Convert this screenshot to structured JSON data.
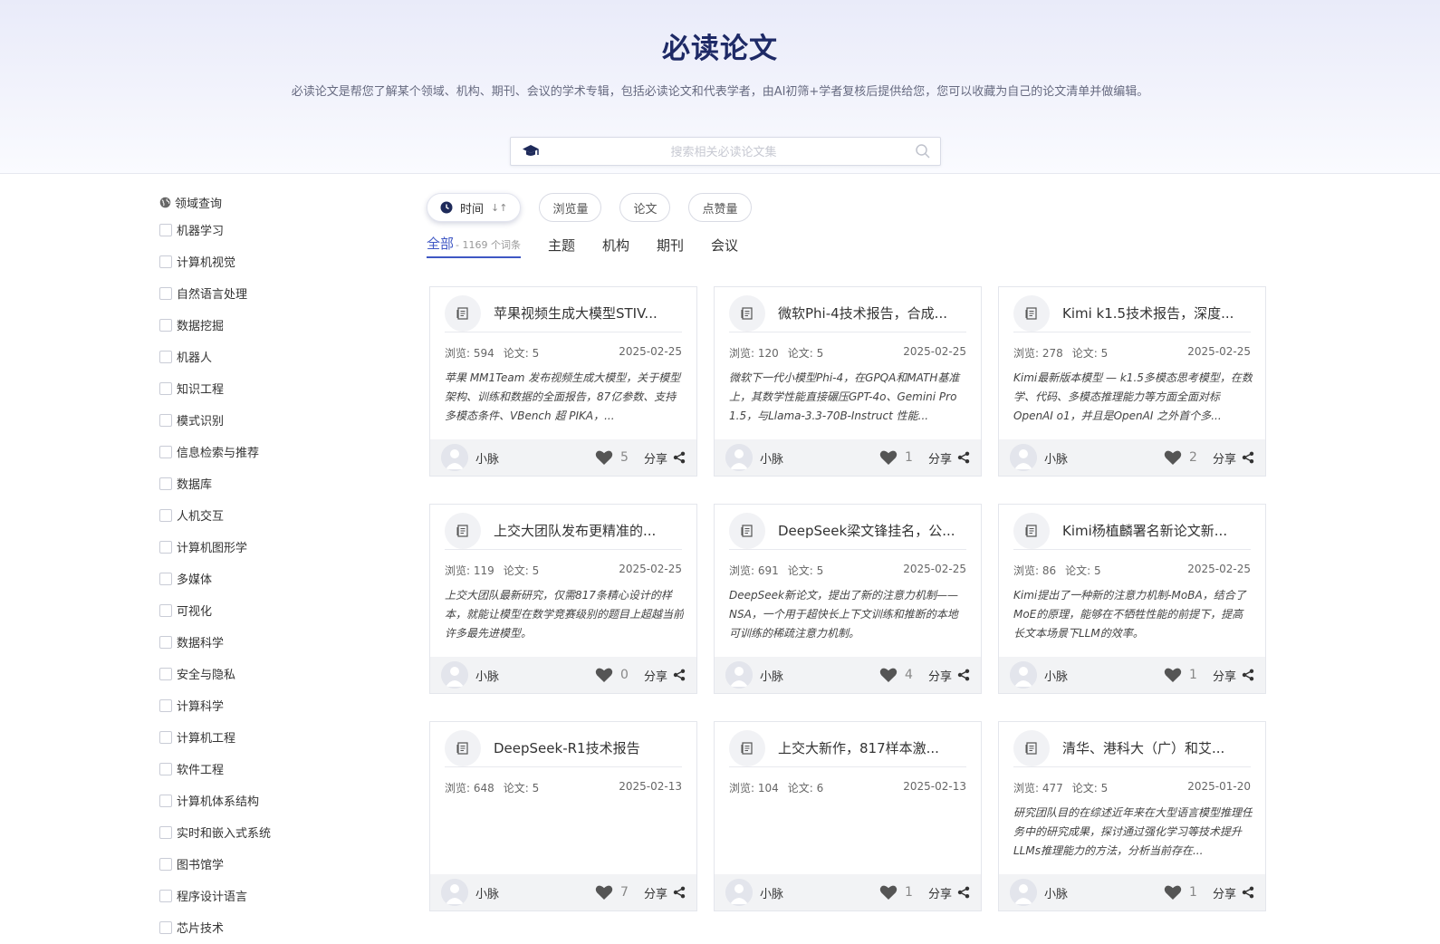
{
  "header": {
    "title": "必读论文",
    "subtitle": "必读论文是帮您了解某个领域、机构、期刊、会议的学术专辑，包括必读论文和代表学者，由AI初筛+学者复核后提供给您，您可以收藏为自己的论文清单并做编辑。",
    "search_placeholder": "搜索相关必读论文集"
  },
  "sidebar": {
    "heading": "领域查询",
    "items": [
      "机器学习",
      "计算机视觉",
      "自然语言处理",
      "数据挖掘",
      "机器人",
      "知识工程",
      "模式识别",
      "信息检索与推荐",
      "数据库",
      "人机交互",
      "计算机图形学",
      "多媒体",
      "可视化",
      "数据科学",
      "安全与隐私",
      "计算科学",
      "计算机工程",
      "软件工程",
      "计算机体系结构",
      "实时和嵌入式系统",
      "图书馆学",
      "程序设计语言",
      "芯片技术"
    ]
  },
  "sort": {
    "time": "时间",
    "views": "浏览量",
    "papers": "论文",
    "likes": "点赞量"
  },
  "tabs": {
    "all": "全部",
    "all_count": "- 1169 个词条",
    "topic": "主题",
    "org": "机构",
    "journal": "期刊",
    "conference": "会议"
  },
  "labels": {
    "views": "浏览:",
    "papers": "论文:",
    "share": "分享"
  },
  "cards": [
    {
      "title": "苹果视频生成大模型STIV...",
      "views": "594",
      "papers": "5",
      "date": "2025-02-25",
      "desc": "苹果 MM1Team 发布视频生成大模型，关于模型架构、训练和数据的全面报告，87亿参数、支持多模态条件、VBench 超 PIKA，...",
      "author": "小脉",
      "likes": "5"
    },
    {
      "title": "微软Phi-4技术报告，合成...",
      "views": "120",
      "papers": "5",
      "date": "2025-02-25",
      "desc": "微软下一代小模型Phi-4，在GPQA和MATH基准上，其数学性能直接碾压GPT-4o、Gemini Pro 1.5，与Llama-3.3-70B-Instruct 性能...",
      "author": "小脉",
      "likes": "1"
    },
    {
      "title": "Kimi k1.5技术报告，深度...",
      "views": "278",
      "papers": "5",
      "date": "2025-02-25",
      "desc": "Kimi最新版本模型 — k1.5多模态思考模型，在数学、代码、多模态推理能力等方面全面对标OpenAI o1，并且是OpenAI 之外首个多...",
      "author": "小脉",
      "likes": "2"
    },
    {
      "title": "上交大团队发布更精准的...",
      "views": "119",
      "papers": "5",
      "date": "2025-02-25",
      "desc": "上交大团队最新研究，仅需817条精心设计的样本，就能让模型在数学竞赛级别的题目上超越当前许多最先进模型。",
      "author": "小脉",
      "likes": "0"
    },
    {
      "title": "DeepSeek梁文锋挂名，公...",
      "views": "691",
      "papers": "5",
      "date": "2025-02-25",
      "desc": "DeepSeek新论文，提出了新的注意力机制——NSA，一个用于超快长上下文训练和推断的本地可训练的稀疏注意力机制。",
      "author": "小脉",
      "likes": "4"
    },
    {
      "title": "Kimi杨植麟署名新论文新...",
      "views": "86",
      "papers": "5",
      "date": "2025-02-25",
      "desc": "Kimi提出了一种新的注意力机制-MoBA，结合了MoE的原理，能够在不牺牲性能的前提下，提高长文本场景下LLM的效率。",
      "author": "小脉",
      "likes": "1"
    },
    {
      "title": "DeepSeek-R1技术报告",
      "views": "648",
      "papers": "5",
      "date": "2025-02-13",
      "desc": "",
      "author": "小脉",
      "likes": "7"
    },
    {
      "title": "上交大新作，817样本激...",
      "views": "104",
      "papers": "6",
      "date": "2025-02-13",
      "desc": "",
      "author": "小脉",
      "likes": "1"
    },
    {
      "title": "清华、港科大（广）和艾...",
      "views": "477",
      "papers": "5",
      "date": "2025-01-20",
      "desc": "研究团队目的在综述近年来在大型语言模型推理任务中的研究成果，探讨通过强化学习等技术提升LLMs推理能力的方法，分析当前存在...",
      "author": "小脉",
      "likes": "1"
    }
  ]
}
